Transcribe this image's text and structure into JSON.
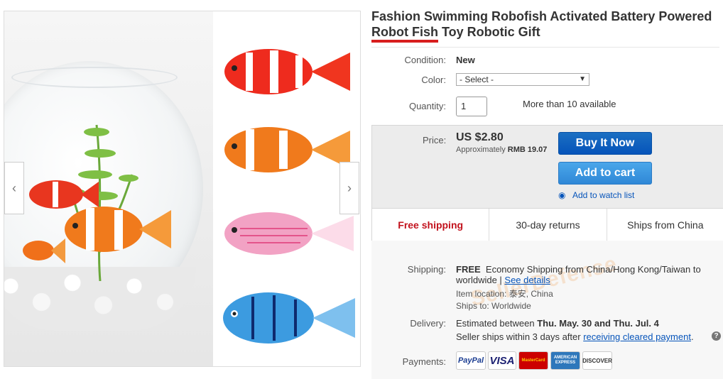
{
  "listing": {
    "title_part1": "Fashion Swimming Robofish Activated Battery Powered",
    "title_highlight": "Robot Fish",
    "title_part2": " Toy Robotic Gift"
  },
  "condition": {
    "label": "Condition:",
    "value": "New"
  },
  "color": {
    "label": "Color:",
    "selected": "- Select -"
  },
  "quantity": {
    "label": "Quantity:",
    "value": "1",
    "availability": "More than 10 available"
  },
  "price": {
    "label": "Price:",
    "value": "US $2.80",
    "approx_prefix": "Approximately ",
    "approx_value": "RMB 19.07"
  },
  "actions": {
    "buy_now": "Buy It Now",
    "add_to_cart": "Add to cart",
    "watch": "Add to watch list"
  },
  "highlights": [
    "Free shipping",
    "30-day returns",
    "Ships from China"
  ],
  "shipping": {
    "label": "Shipping:",
    "free": "FREE",
    "text": "Economy Shipping from China/Hong Kong/Taiwan to",
    "text2": "worldwide | ",
    "see_details": "See details",
    "item_location": "Item location:",
    "item_location_value": "泰安, China",
    "ships_to": "Ships to:",
    "ships_to_value": "Worldwide"
  },
  "delivery": {
    "label": "Delivery:",
    "prefix": "Estimated between ",
    "dates": "Thu. May. 30 and Thu. Jul. 4",
    "seller_prefix": "Seller ships within 3 days after ",
    "seller_link": "receiving cleared payment",
    "seller_suffix": ".",
    "help": "?"
  },
  "payments": {
    "label": "Payments:",
    "methods": [
      "PayPal",
      "VISA",
      "MasterCard",
      "AMERICAN EXPRESS",
      "DISCOVER"
    ]
  },
  "watermark": "SellerDefense",
  "gallery": {
    "prev": "‹",
    "next": "›"
  },
  "colors": {
    "accent_blue": "#0654ba",
    "cart_blue": "#2f87d6",
    "free_red": "#c2121d",
    "highlight_red": "#d81e1e"
  }
}
